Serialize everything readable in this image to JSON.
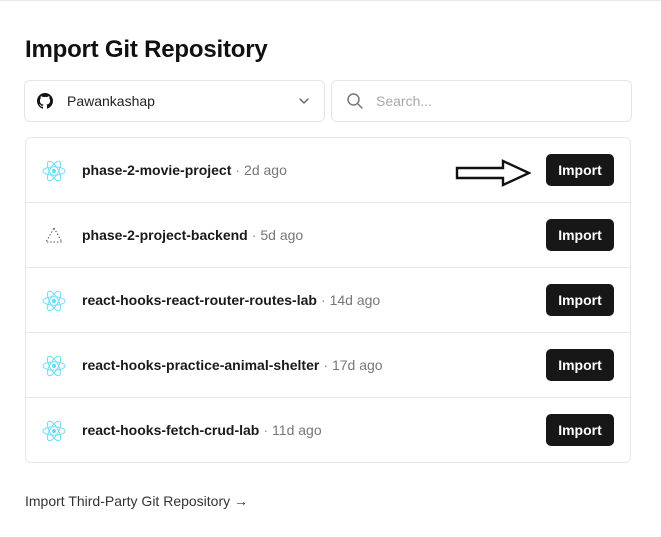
{
  "title": "Import Git Repository",
  "account": {
    "name": "Pawankashap"
  },
  "search": {
    "placeholder": "Search..."
  },
  "repos": [
    {
      "name": "phase-2-movie-project",
      "separator": "·",
      "ago": "2d ago",
      "icon": "react-icon"
    },
    {
      "name": "phase-2-project-backend",
      "separator": "·",
      "ago": "5d ago",
      "icon": "triangle-icon"
    },
    {
      "name": "react-hooks-react-router-routes-lab",
      "separator": "·",
      "ago": "14d ago",
      "icon": "react-icon"
    },
    {
      "name": "react-hooks-practice-animal-shelter",
      "separator": "·",
      "ago": "17d ago",
      "icon": "react-icon"
    },
    {
      "name": "react-hooks-fetch-crud-lab",
      "separator": "·",
      "ago": "11d ago",
      "icon": "react-icon"
    }
  ],
  "import_label": "Import",
  "third_party_link": "Import Third-Party Git Repository →",
  "colors": {
    "button_bg": "#171717",
    "react_icon": "#61dafb",
    "border": "#e6e6e6"
  }
}
